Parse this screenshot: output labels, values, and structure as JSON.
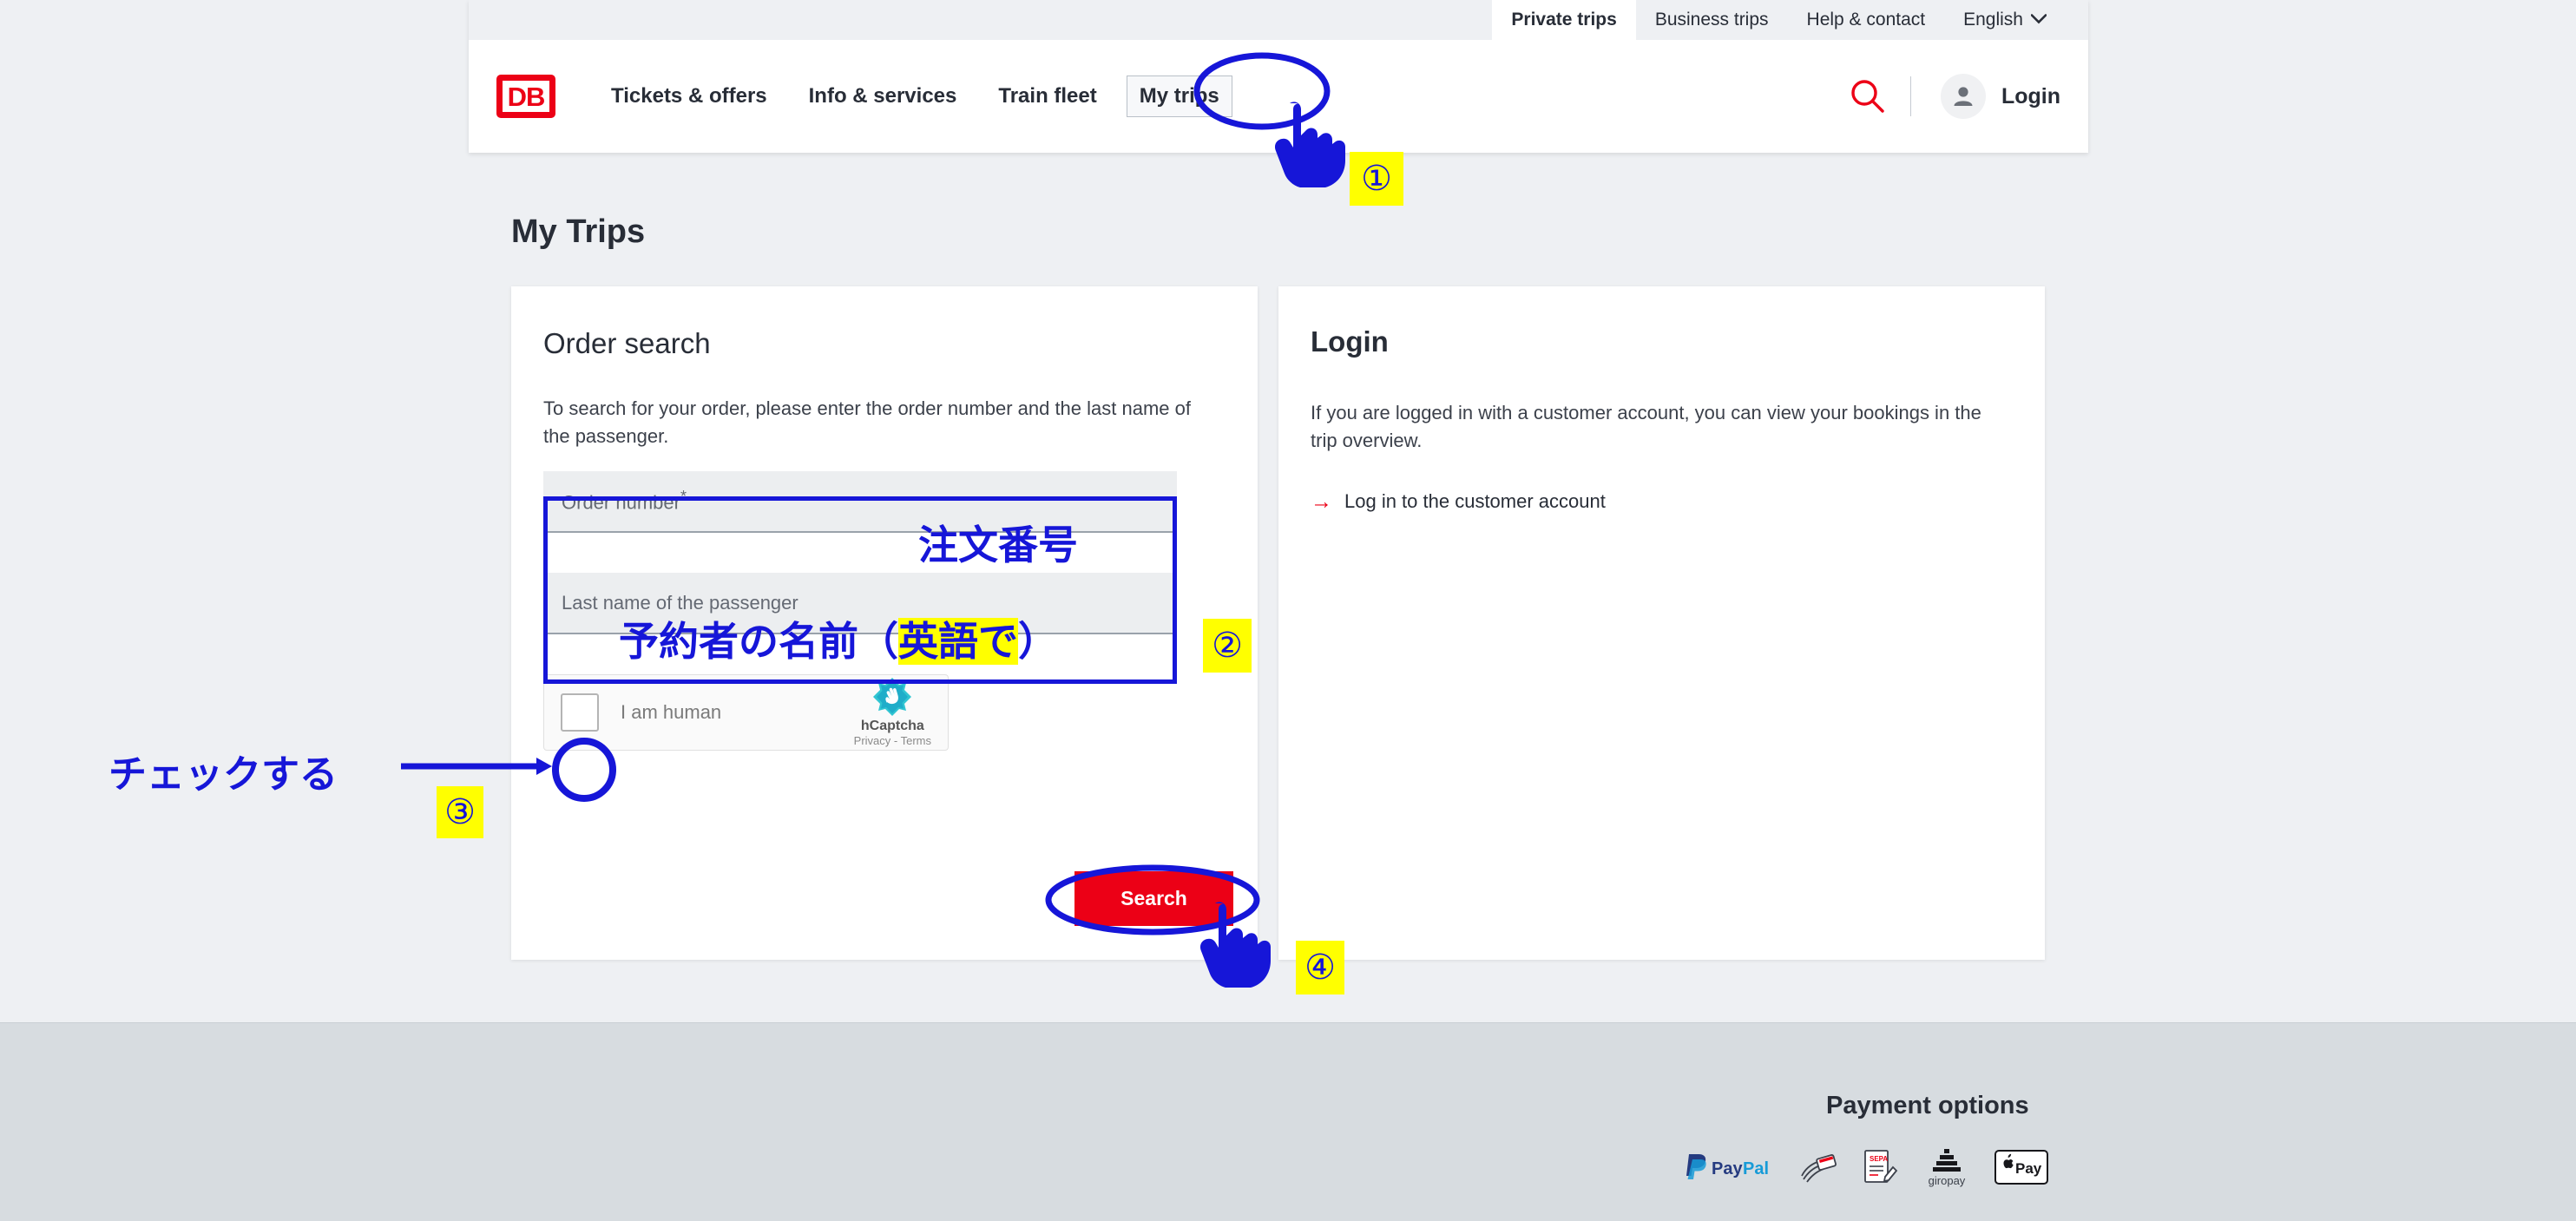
{
  "meta_nav": [
    {
      "label": "Private trips",
      "active": true
    },
    {
      "label": "Business trips",
      "active": false
    },
    {
      "label": "Help & contact",
      "active": false
    },
    {
      "label": "English",
      "active": false,
      "chevron": "⌄"
    }
  ],
  "brand": {
    "logo_text": "DB"
  },
  "main_nav": [
    {
      "label": "Tickets & offers",
      "boxed": false
    },
    {
      "label": "Info & services",
      "boxed": false
    },
    {
      "label": "Train fleet",
      "boxed": false
    },
    {
      "label": "My trips",
      "boxed": true
    }
  ],
  "header_actions": {
    "login_label": "Login"
  },
  "page": {
    "title": "My Trips"
  },
  "order_search": {
    "heading": "Order search",
    "description": "To search for your order, please enter the order number and the last name of the passenger.",
    "fields": [
      {
        "placeholder": "Order number",
        "required_mark": "*"
      },
      {
        "placeholder": "Last name of the passenger",
        "required_mark": ""
      }
    ],
    "captcha": {
      "label": "I am human",
      "brand": "hCaptcha",
      "terms": "Privacy - Terms"
    },
    "submit_label": "Search"
  },
  "login_card": {
    "heading": "Login",
    "description": "If you are logged in with a customer account, you can view your bookings in the trip overview.",
    "link_label": "Log in to the customer account",
    "link_arrow": "→"
  },
  "footer": {
    "payment_title": "Payment options",
    "payment_methods": [
      "PayPal",
      "Credit card",
      "SEPA direct debit",
      "giropay",
      "Apple Pay"
    ]
  },
  "annotations": {
    "step1_badge": "①",
    "step2_badge": "②",
    "step3_badge": "③",
    "step4_badge": "④",
    "order_number_jp": "注文番号",
    "last_name_jp_1": "予約者の名前（",
    "last_name_jp_hl": "英語で",
    "last_name_jp_2": "）",
    "check_jp": "チェックする"
  },
  "colors": {
    "brand_red": "#ec0016",
    "annotation_blue": "#1616d8",
    "badge_yellow": "#ffff00",
    "page_bg": "#eef0f3",
    "footer_bg": "#d7dce0"
  }
}
